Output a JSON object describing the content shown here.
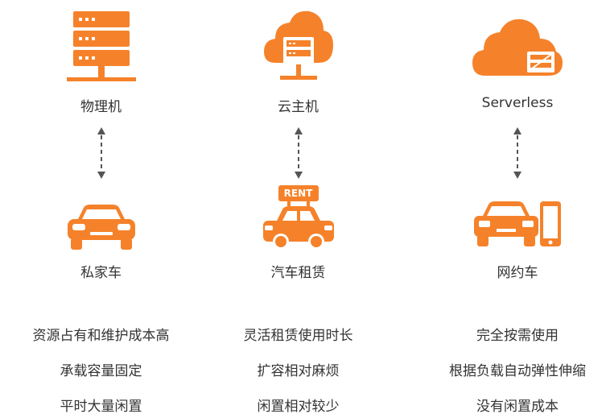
{
  "columns": [
    {
      "top_label": "物理机",
      "bottom_label": "私家车",
      "descriptions": [
        "资源占有和维护成本高",
        "承载容量固定",
        "平时大量闲置"
      ]
    },
    {
      "top_label": "云主机",
      "bottom_label": "汽车租赁",
      "rent_sign": "RENT",
      "descriptions": [
        "灵活租赁使用时长",
        "扩容相对麻烦",
        "闲置相对较少"
      ]
    },
    {
      "top_label": "Serverless",
      "bottom_label": "网约车",
      "descriptions": [
        "完全按需使用",
        "根据负载自动弹性伸缩",
        "没有闲置成本"
      ]
    }
  ],
  "colors": {
    "accent": "#F5822A",
    "arrow": "#555555",
    "text": "#333333"
  },
  "icons": [
    "server-rack-icon",
    "cloud-server-icon",
    "cloud-serverless-icon",
    "car-icon",
    "rent-car-icon",
    "car-phone-icon",
    "double-arrow-icon"
  ]
}
